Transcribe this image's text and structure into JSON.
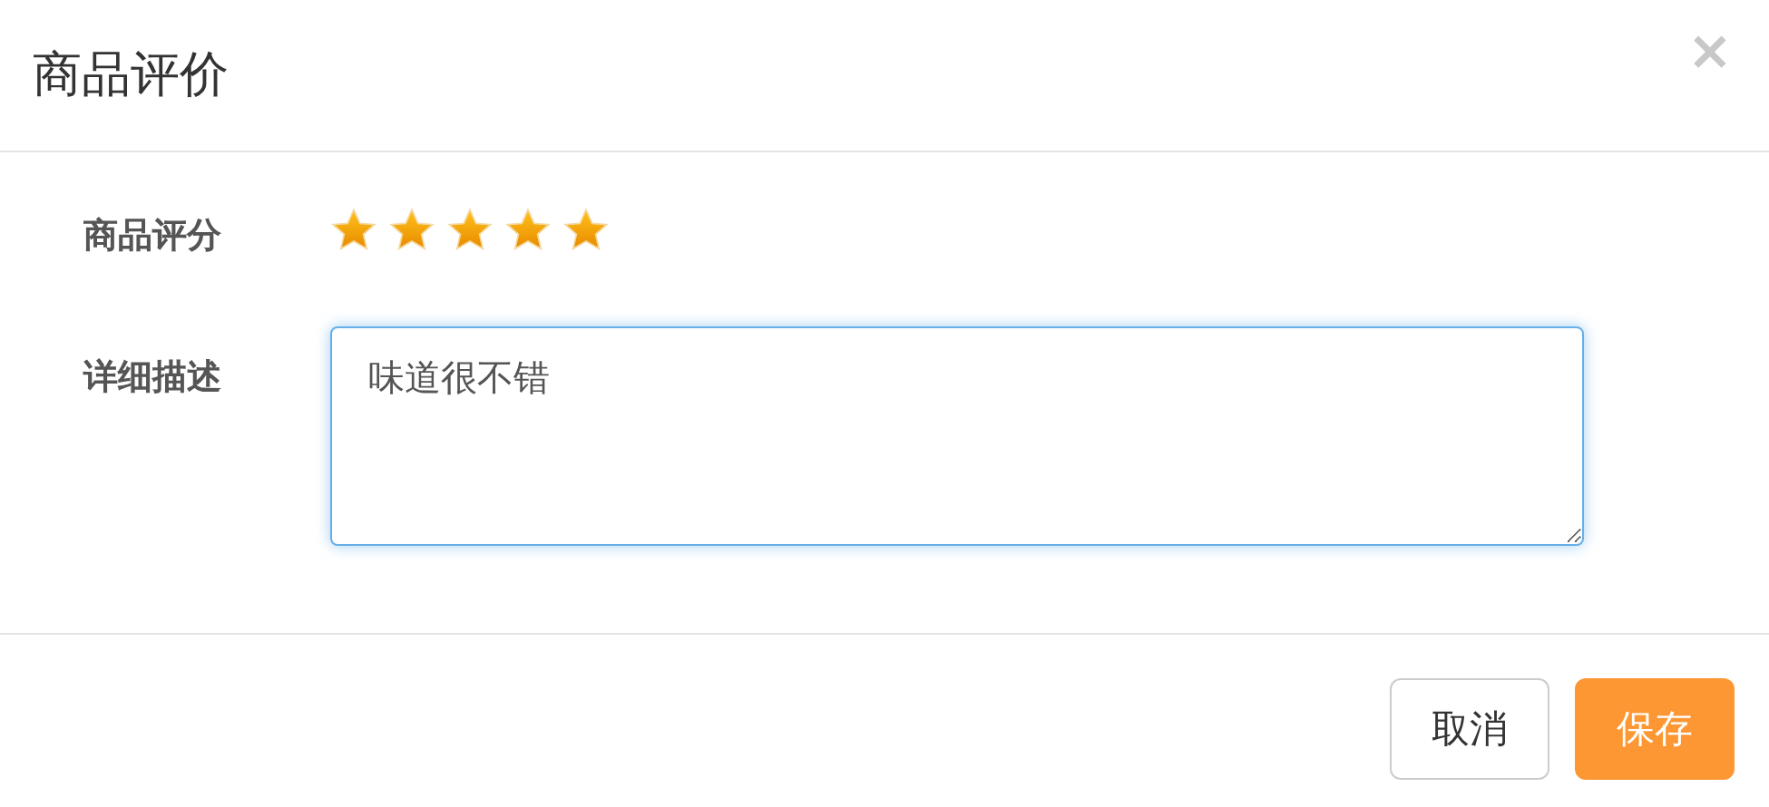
{
  "dialog": {
    "title": "商品评价",
    "close": "×"
  },
  "form": {
    "rating": {
      "label": "商品评分",
      "stars": 5
    },
    "description": {
      "label": "详细描述",
      "value": "味道很不错"
    }
  },
  "buttons": [
    {
      "label": "取消",
      "kind": "default"
    },
    {
      "label": "保存",
      "kind": "primary"
    }
  ]
}
